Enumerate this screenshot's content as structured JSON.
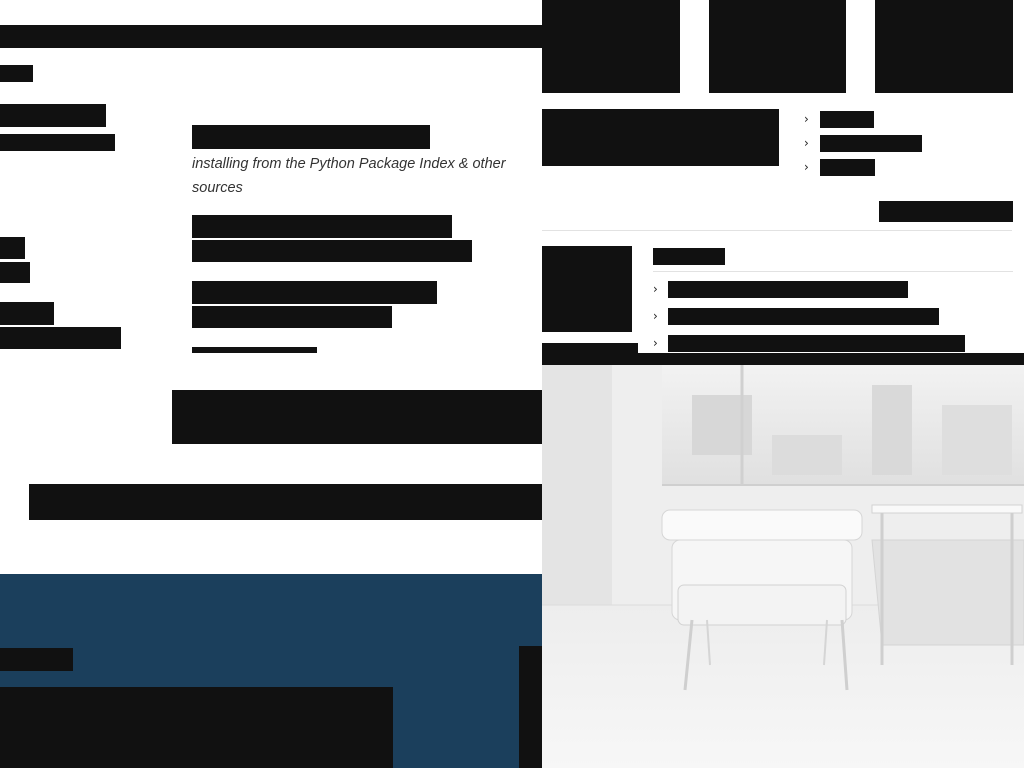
{
  "page": {
    "subtitle": "installing from the Python Package Index & other sources"
  },
  "colors": {
    "redaction": "#111111",
    "footer_band": "#1b3f5c",
    "divider": "#e2e2e2",
    "text": "#333333"
  },
  "icons": {
    "list_marker": "chevron-right-icon",
    "photo": "interior-photo-armchair"
  },
  "right_nav": {
    "chevron_glyph": "›"
  },
  "content_list": {
    "chevron_glyph": "›"
  }
}
